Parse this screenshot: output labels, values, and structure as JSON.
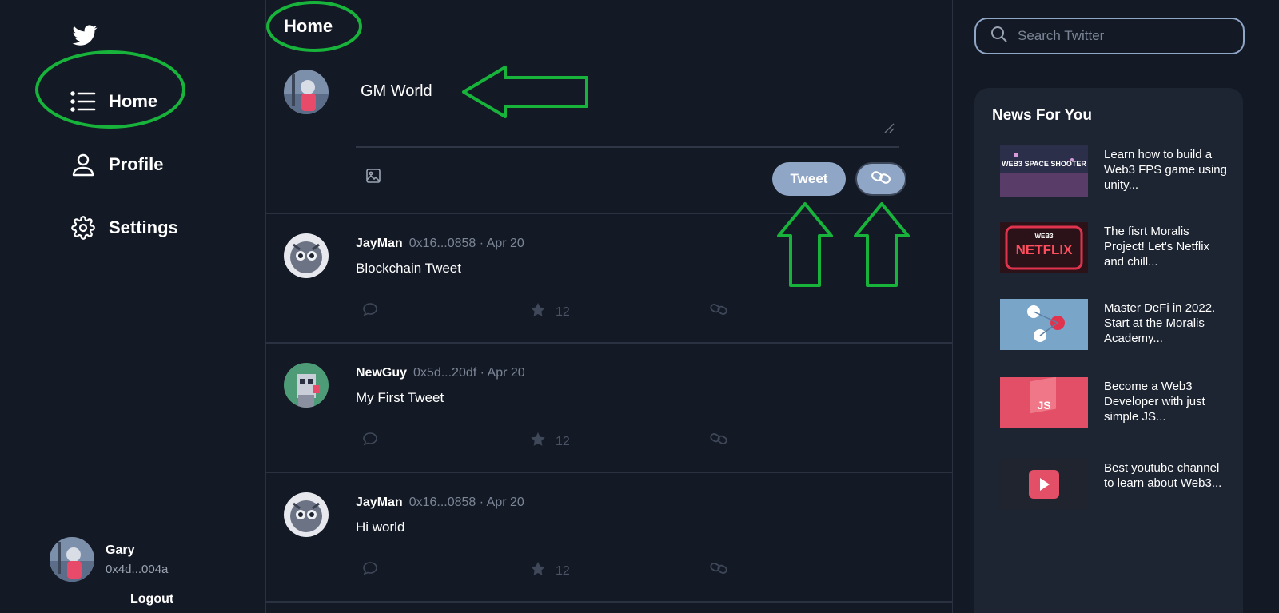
{
  "sidebar": {
    "logo": "twitter-bird-icon",
    "items": [
      {
        "label": "Home",
        "icon": "list-icon"
      },
      {
        "label": "Profile",
        "icon": "person-icon"
      },
      {
        "label": "Settings",
        "icon": "gear-icon"
      }
    ],
    "user": {
      "name": "Gary",
      "address": "0x4d...004a"
    },
    "logout_label": "Logout"
  },
  "feed": {
    "title": "Home",
    "composer": {
      "text": "GM World",
      "tweet_label": "Tweet",
      "image_icon": "image-icon",
      "chain_icon": "chain-link-icon"
    },
    "tweets": [
      {
        "user": "JayMan",
        "meta": "0x16...0858 · Apr 20",
        "body": "Blockchain Tweet",
        "stars": "12"
      },
      {
        "user": "NewGuy",
        "meta": "0x5d...20df · Apr 20",
        "body": "My First Tweet",
        "stars": "12"
      },
      {
        "user": "JayMan",
        "meta": "0x16...0858 · Apr 20",
        "body": "Hi world",
        "stars": "12"
      }
    ]
  },
  "right": {
    "search_placeholder": "Search Twitter",
    "news_title": "News For You",
    "news": [
      {
        "text": "Learn how to build a Web3 FPS game using unity...",
        "thumb_text": "WEB3 SPACE SHOOTER"
      },
      {
        "text": "The fisrt Moralis Project! Let's Netflix and chill...",
        "thumb_text": "NETFLIX",
        "thumb_badge": "WEB3"
      },
      {
        "text": "Master DeFi in 2022. Start at the Moralis Academy...",
        "thumb_text": ""
      },
      {
        "text": "Become a Web3 Developer with just simple JS...",
        "thumb_text": "JS"
      },
      {
        "text": "Best youtube channel to learn about Web3...",
        "thumb_text": ""
      }
    ]
  },
  "colors": {
    "background": "#141a25",
    "accent": "#8fa6c7",
    "annotation": "#17b33a"
  }
}
